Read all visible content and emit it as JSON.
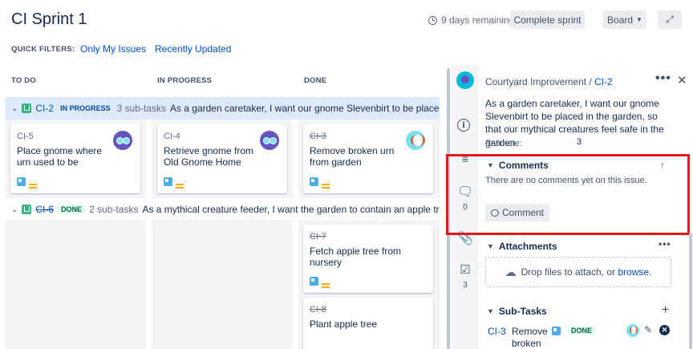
{
  "header": {
    "title": "CI Sprint 1",
    "remaining": "9 days remaining",
    "complete_btn": "Complete sprint",
    "board_btn": "Board",
    "quick_filters_label": "QUICK FILTERS:",
    "filters": [
      "Only My Issues",
      "Recently Updated"
    ]
  },
  "columns": [
    "TO DO",
    "IN PROGRESS",
    "DONE"
  ],
  "swimlanes": [
    {
      "key": "CI-2",
      "status": "IN PROGRESS",
      "subtasks": "3 sub-tasks",
      "summary": "As a garden caretaker, I want our gnome Slevenbirt to be placed in t..."
    },
    {
      "key": "CI-6",
      "status": "DONE",
      "subtasks": "2 sub-tasks",
      "summary": "As a mythical creature feeder, I want the garden to contain an apple tree, s..."
    }
  ],
  "cards": [
    {
      "key": "CI-5",
      "summary": "Place gnome where urn used to be"
    },
    {
      "key": "CI-4",
      "summary": "Retrieve gnome from Old Gnome Home"
    },
    {
      "key": "CI-3",
      "summary": "Remove broken urn from garden"
    },
    {
      "key": "CI-7",
      "summary": "Fetch apple tree from nursery"
    },
    {
      "key": "CI-8",
      "summary": "Plant apple tree"
    }
  ],
  "sidenav": {
    "comments_count": "0",
    "checklist_count": "3"
  },
  "detail": {
    "project": "Courtyard Improvement",
    "separator": " / ",
    "issue_key": "CI-2",
    "description": "As a garden caretaker, I want our gnome Slevenbirt to be placed in the garden, so that our mythical creatures feel safe in the garden.",
    "estimate_label": "Estimate:",
    "estimate_value": "3",
    "comments_title": "Comments",
    "no_comments": "There are no comments yet on this issue.",
    "comment_btn": "Comment",
    "attachments_title": "Attachments",
    "drop_text": "Drop files to attach, or ",
    "browse_link": "browse.",
    "subtasks_title": "Sub-Tasks",
    "subtask": {
      "key": "CI-3",
      "summary": "Remove broken",
      "status": "DONE"
    }
  },
  "colors": {
    "link": "#0052cc",
    "highlight": "#e3171c",
    "lane_bg": "#deebff",
    "done_green": "#006644"
  }
}
